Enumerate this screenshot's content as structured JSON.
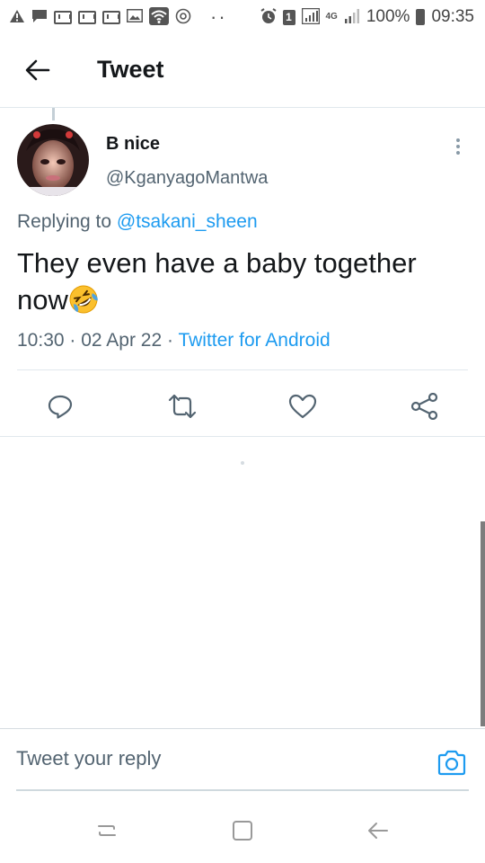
{
  "status_bar": {
    "left_icons": [
      "warning-icon",
      "chat-icon",
      "gmail-icon",
      "gmail-icon",
      "gmail-icon",
      "image-icon",
      "wifi-icon",
      "sync-icon",
      "more-dots-icon"
    ],
    "right_icons": [
      "alarm-icon",
      "sim-icon",
      "signal-icon",
      "lte-icon",
      "signal-icon",
      "battery-icon"
    ],
    "sim_number": "1",
    "network": "4G",
    "battery": "100%",
    "time": "09:35"
  },
  "header": {
    "title": "Tweet"
  },
  "tweet": {
    "author_name": "B nice",
    "author_handle": "@KganyagoMantwa",
    "replying_prefix": "Replying to",
    "replying_to": "@tsakani_sheen",
    "text": "They even have a baby together now",
    "emoji": "rolling-on-floor-laughing-emoji",
    "time": "10:30",
    "date": "02 Apr 22",
    "source": "Twitter for Android",
    "actions": [
      "reply-icon",
      "retweet-icon",
      "like-icon",
      "share-icon"
    ]
  },
  "reply": {
    "placeholder": "Tweet your reply"
  },
  "colors": {
    "accent": "#1d9bf0",
    "text": "#14171a",
    "secondary": "#536471",
    "divider": "#e1e8ed"
  }
}
